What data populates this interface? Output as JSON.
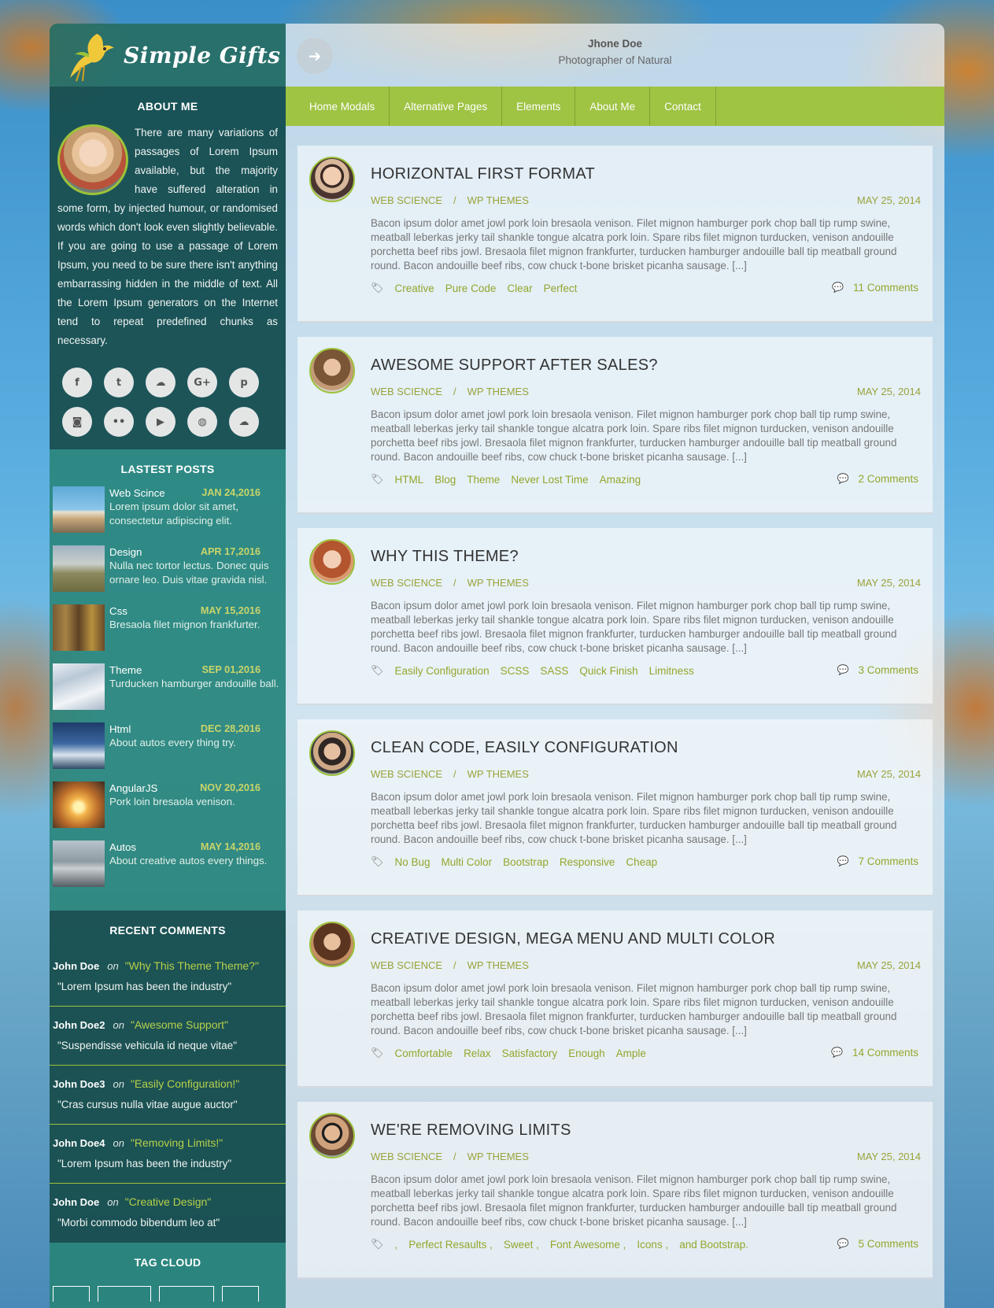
{
  "brand": {
    "name": "Simple Gifts"
  },
  "owner": {
    "name": "Jhone Doe",
    "subtitle": "Photographer of Natural"
  },
  "nav": [
    "Home Modals",
    "Alternative Pages",
    "Elements",
    "About Me",
    "Contact"
  ],
  "about": {
    "title": "ABOUT ME",
    "text": "There are many variations of passages of Lorem Ipsum available, but the majority have suffered alteration in some form, by injected humour, or randomised words which don't look even slightly believable. If you are going to use a passage of Lorem Ipsum, you need to be sure there isn't anything embarrassing hidden in the middle of text. All the Lorem Ipsum generators on the Internet tend to repeat predefined chunks as necessary."
  },
  "social": [
    {
      "icon": "facebook-icon",
      "glyph": "f"
    },
    {
      "icon": "twitter-icon",
      "glyph": "t"
    },
    {
      "icon": "soundcloud-icon",
      "glyph": "☁"
    },
    {
      "icon": "google-plus-icon",
      "glyph": "G+"
    },
    {
      "icon": "pinterest-icon",
      "glyph": "p"
    },
    {
      "icon": "instagram-icon",
      "glyph": "◙"
    },
    {
      "icon": "flickr-icon",
      "glyph": "••"
    },
    {
      "icon": "youtube-icon",
      "glyph": "▶"
    },
    {
      "icon": "dribbble-icon",
      "glyph": "◍"
    },
    {
      "icon": "cloud-icon",
      "glyph": "☁"
    }
  ],
  "latest_posts": {
    "title": "LASTEST POSTS",
    "items": [
      {
        "category": "Web Scince",
        "date": "JAN 24,2016",
        "desc": "Lorem ipsum dolor sit amet, consectetur adipiscing elit."
      },
      {
        "category": "Design",
        "date": "APR 17,2016",
        "desc": "Nulla nec tortor lectus. Donec quis ornare leo. Duis vitae gravida nisl."
      },
      {
        "category": "Css",
        "date": "MAY 15,2016",
        "desc": "Bresaola filet mignon frankfurter."
      },
      {
        "category": "Theme",
        "date": "SEP 01,2016",
        "desc": "Turducken hamburger andouille ball."
      },
      {
        "category": "Html",
        "date": "DEC 28,2016",
        "desc": "About autos every thing try."
      },
      {
        "category": "AngularJS",
        "date": "NOV 20,2016",
        "desc": "Pork loin bresaola venison."
      },
      {
        "category": "Autos",
        "date": "MAY 14,2016",
        "desc": "About creative autos every things."
      }
    ]
  },
  "recent_comments": {
    "title": "RECENT COMMENTS",
    "on": "on",
    "items": [
      {
        "author": "John Doe",
        "post": "\"Why This Theme Theme?\"",
        "text": "\"Lorem Ipsum has been the industry\""
      },
      {
        "author": "John Doe2",
        "post": "\"Awesome Support\"",
        "text": "\"Suspendisse vehicula id neque vitae\""
      },
      {
        "author": "John Doe3",
        "post": "\"Easily Configuration!\"",
        "text": "\"Cras cursus nulla vitae augue auctor\""
      },
      {
        "author": "John Doe4",
        "post": "\"Removing Limits!\"",
        "text": "\"Lorem Ipsum has been the industry\""
      },
      {
        "author": "John Doe",
        "post": "\"Creative Design\"",
        "text": "\"Morbi commodo bibendum leo at\""
      }
    ]
  },
  "tag_cloud": {
    "title": "TAG CLOUD"
  },
  "posts": [
    {
      "title": "HORIZONTAL FIRST FORMAT",
      "cat1": "WEB SCIENCE",
      "cat2": "WP THEMES",
      "date": "MAY 25, 2014",
      "excerpt": "Bacon ipsum dolor amet jowl pork loin bresaola venison. Filet mignon hamburger pork chop ball tip rump swine, meatball leberkas jerky tail shankle tongue alcatra pork loin. Spare ribs filet mignon turducken, venison andouille porchetta beef ribs jowl. Bresaola filet mignon frankfurter, turducken hamburger andouille ball tip meatball ground round. Bacon andouille beef ribs, cow chuck t-bone brisket picanha sausage. [...]",
      "tags": [
        "Creative",
        "Pure Code",
        "Clear",
        "Perfect"
      ],
      "comments": "11 Comments"
    },
    {
      "title": "AWESOME SUPPORT AFTER SALES?",
      "cat1": "WEB SCIENCE",
      "cat2": "WP THEMES",
      "date": "MAY 25, 2014",
      "excerpt": "Bacon ipsum dolor amet jowl pork loin bresaola venison. Filet mignon hamburger pork chop ball tip rump swine, meatball leberkas jerky tail shankle tongue alcatra pork loin. Spare ribs filet mignon turducken, venison andouille porchetta beef ribs jowl. Bresaola filet mignon frankfurter, turducken hamburger andouille ball tip meatball ground round. Bacon andouille beef ribs, cow chuck t-bone brisket picanha sausage. [...]",
      "tags": [
        "HTML",
        "Blog",
        "Theme",
        "Never Lost Time",
        "Amazing"
      ],
      "comments": "2 Comments"
    },
    {
      "title": "WHY THIS THEME?",
      "cat1": "WEB SCIENCE",
      "cat2": "WP THEMES",
      "date": "MAY 25, 2014",
      "excerpt": "Bacon ipsum dolor amet jowl pork loin bresaola venison. Filet mignon hamburger pork chop ball tip rump swine, meatball leberkas jerky tail shankle tongue alcatra pork loin. Spare ribs filet mignon turducken, venison andouille porchetta beef ribs jowl. Bresaola filet mignon frankfurter, turducken hamburger andouille ball tip meatball ground round. Bacon andouille beef ribs, cow chuck t-bone brisket picanha sausage. [...]",
      "tags": [
        "Easily Configuration",
        "SCSS",
        "SASS",
        "Quick Finish",
        "Limitness"
      ],
      "comments": "3 Comments"
    },
    {
      "title": "CLEAN CODE, EASILY CONFIGURATION",
      "cat1": "WEB SCIENCE",
      "cat2": "WP THEMES",
      "date": "MAY 25, 2014",
      "excerpt": "Bacon ipsum dolor amet jowl pork loin bresaola venison. Filet mignon hamburger pork chop ball tip rump swine, meatball leberkas jerky tail shankle tongue alcatra pork loin. Spare ribs filet mignon turducken, venison andouille porchetta beef ribs jowl. Bresaola filet mignon frankfurter, turducken hamburger andouille ball tip meatball ground round. Bacon andouille beef ribs, cow chuck t-bone brisket picanha sausage. [...]",
      "tags": [
        "No Bug",
        "Multi Color",
        "Bootstrap",
        "Responsive",
        "Cheap"
      ],
      "comments": "7 Comments"
    },
    {
      "title": "CREATIVE DESIGN, MEGA MENU AND MULTI COLOR",
      "cat1": "WEB SCIENCE",
      "cat2": "WP THEMES",
      "date": "MAY 25, 2014",
      "excerpt": "Bacon ipsum dolor amet jowl pork loin bresaola venison. Filet mignon hamburger pork chop ball tip rump swine, meatball leberkas jerky tail shankle tongue alcatra pork loin. Spare ribs filet mignon turducken, venison andouille porchetta beef ribs jowl. Bresaola filet mignon frankfurter, turducken hamburger andouille ball tip meatball ground round. Bacon andouille beef ribs, cow chuck t-bone brisket picanha sausage. [...]",
      "tags": [
        "Comfortable",
        "Relax",
        "Satisfactory",
        "Enough",
        "Ample"
      ],
      "comments": "14 Comments"
    },
    {
      "title": "WE'RE REMOVING LIMITS",
      "cat1": "WEB SCIENCE",
      "cat2": "WP THEMES",
      "date": "MAY 25, 2014",
      "excerpt": "Bacon ipsum dolor amet jowl pork loin bresaola venison. Filet mignon hamburger pork chop ball tip rump swine, meatball leberkas jerky tail shankle tongue alcatra pork loin. Spare ribs filet mignon turducken, venison andouille porchetta beef ribs jowl. Bresaola filet mignon frankfurter, turducken hamburger andouille ball tip meatball ground round. Bacon andouille beef ribs, cow chuck t-bone brisket picanha sausage. [...]",
      "tags": [
        ",",
        "Perfect Resaults ,",
        "Sweet ,",
        "Font Awesome ,",
        "Icons ,",
        "and Bootstrap."
      ],
      "comments": "5 Comments"
    }
  ],
  "colors": {
    "accent": "#9cc23a",
    "sidebar_dark": "#184e4e",
    "sidebar_mid": "#28847a",
    "link": "#94a62c"
  }
}
